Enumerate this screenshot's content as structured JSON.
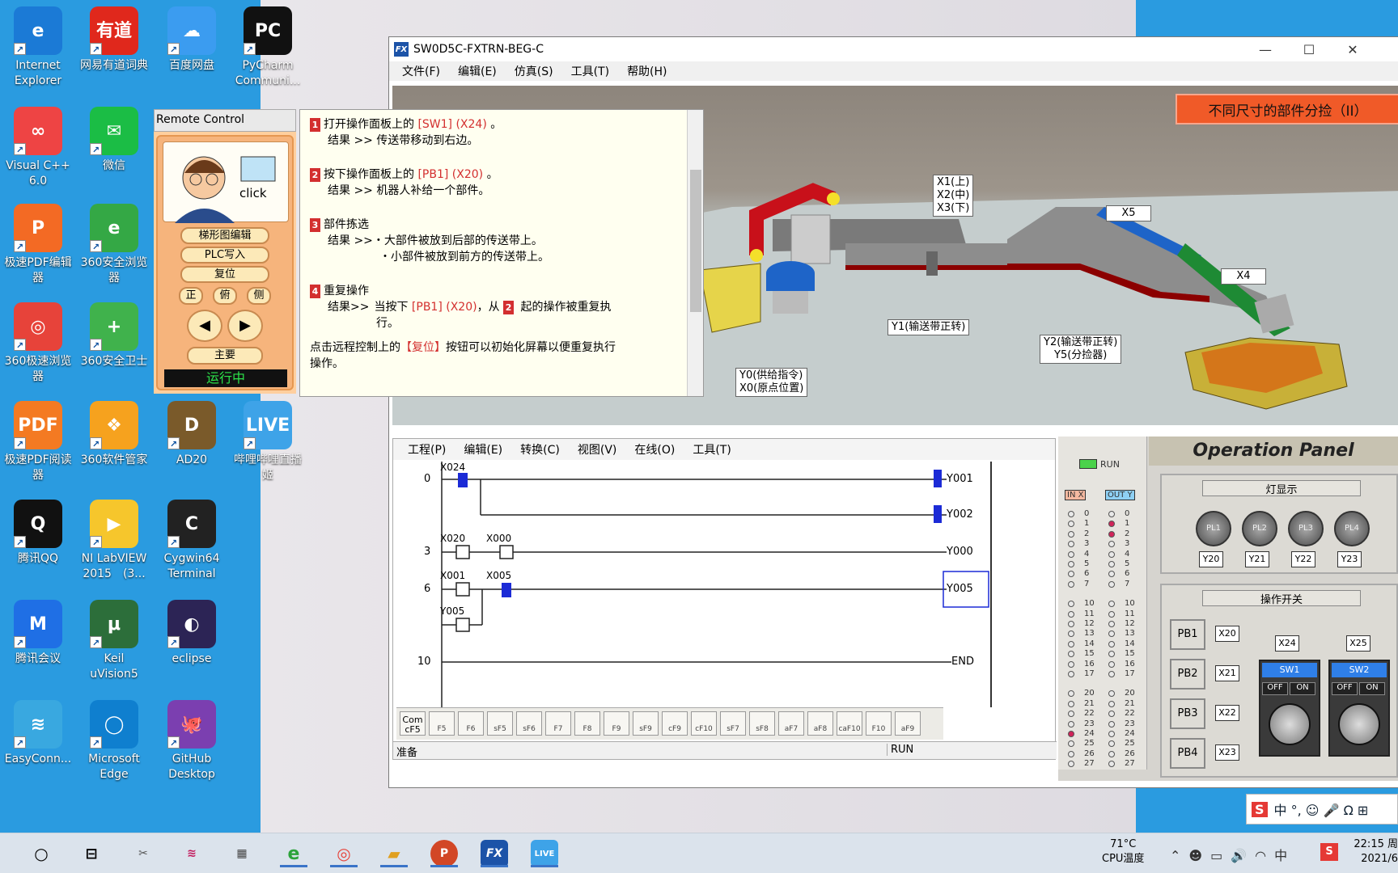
{
  "desktop": {
    "icons": [
      {
        "label": "Internet\nExplorer",
        "color": "#1b7ad6",
        "g": "e"
      },
      {
        "label": "网易有道词典",
        "color": "#e0281c",
        "g": "有道"
      },
      {
        "label": "百度网盘",
        "color": "#3b9cf0",
        "g": "☁"
      },
      {
        "label": "PyCharm\nCommuni...",
        "color": "#111",
        "g": "PC"
      },
      {
        "label": "Visual C++\n6.0",
        "color": "#e44",
        "g": "∞"
      },
      {
        "label": "微信",
        "color": "#1bbd45",
        "g": "✉"
      },
      {
        "label": "极速PDF编辑\n器",
        "color": "#f36a24",
        "g": "P"
      },
      {
        "label": "360安全浏览\n器",
        "color": "#34a845",
        "g": "e"
      },
      {
        "label": "360极速浏览\n器",
        "color": "#e7433a",
        "g": "◎"
      },
      {
        "label": "360安全卫士",
        "color": "#40b24c",
        "g": "+"
      },
      {
        "label": "极速PDF阅读\n器",
        "color": "#f47a22",
        "g": "PDF"
      },
      {
        "label": "360软件管家",
        "color": "#f6a21e",
        "g": "❖"
      },
      {
        "label": "AD20",
        "color": "#7a5a2a",
        "g": "D"
      },
      {
        "label": "哔哩哔哩直播\n姬",
        "color": "#3ea3e8",
        "g": "LIVE"
      },
      {
        "label": "腾讯QQ",
        "color": "#111",
        "g": "Q"
      },
      {
        "label": "NI LabVIEW\n2015　(3...",
        "color": "#f6c62c",
        "g": "▶"
      },
      {
        "label": "Cygwin64\nTerminal",
        "color": "#222",
        "g": "C"
      },
      {
        "label": "腾讯会议",
        "color": "#1f6fe5",
        "g": "M"
      },
      {
        "label": "Keil\nuVision5",
        "color": "#2c6e3a",
        "g": "μ"
      },
      {
        "label": "eclipse",
        "color": "#2c2455",
        "g": "◐"
      },
      {
        "label": "EasyConn...",
        "color": "#39a8e0",
        "g": "≋"
      },
      {
        "label": "Microsoft\nEdge",
        "color": "#0f7fcf",
        "g": "◯"
      },
      {
        "label": "GitHub\nDesktop",
        "color": "#7b3fb0",
        "g": "🐙"
      }
    ]
  },
  "window": {
    "title": "SW0D5C-FXTRN-BEG-C",
    "logo": "FX",
    "minimize": "—",
    "maximize": "☐",
    "close": "✕",
    "menu": [
      "文件(F)",
      "编辑(E)",
      "仿真(S)",
      "工具(T)",
      "帮助(H)"
    ]
  },
  "scene": {
    "title": "不同尺寸的部件分捡（II）",
    "labels": {
      "x123": "X1(上)\nX2(中)\nX3(下)",
      "x5": "X5",
      "x4": "X4",
      "y1": "Y1(输送带正转)",
      "y25": "Y2(输送带正转)\nY5(分捡器)",
      "y0x0": "Y0(供给指令)\nX0(原点位置)"
    }
  },
  "remote": {
    "header": "Remote Control",
    "click": "click",
    "b1": "梯形图编辑",
    "b2": "PLC写入",
    "b3": "复位",
    "v1": "正",
    "v2": "俯",
    "v3": "侧",
    "prev": "◀",
    "next": "▶",
    "main": "主要",
    "status": "运行中"
  },
  "help": {
    "s1n": "1",
    "s1a": "打开操作面板上的 ",
    "s1r": "[SW1] (X24)",
    "s1b": " 。",
    "s1res": "结果 >> 传送带移动到右边。",
    "s2n": "2",
    "s2a": "按下操作面板上的 ",
    "s2r": "[PB1] (X20)",
    "s2b": " 。",
    "s2res": "结果 >> 机器人补给一个部件。",
    "s3n": "3",
    "s3a": "部件拣选",
    "s3res1": "结果 >>・大部件被放到后部的传送带上。",
    "s3res2": "・小部件被放到前方的传送带上。",
    "s4n": "4",
    "s4a": "重复操作",
    "s4res": "结果>>",
    "s4t1": "当按下 ",
    "s4r": "[PB1] (X20)",
    "s4t2": "，从 ",
    "s4n2": "2",
    "s4t3": " 起的操作被重复执",
    "s4t4": "行。",
    "foot1": "点击远程控制上的",
    "foot2": "【复位】",
    "foot3": "按钮可以初始化屏幕以便重复执行",
    "foot4": "操作。"
  },
  "ladder": {
    "menu": [
      "工程(P)",
      "编辑(E)",
      "转换(C)",
      "视图(V)",
      "在线(O)",
      "工具(T)"
    ],
    "steps": [
      "0",
      "3",
      "6",
      "10"
    ],
    "c": {
      "x024": "X024",
      "x020": "X020",
      "x000": "X000",
      "x001": "X001",
      "x005": "X005",
      "y005c": "Y005"
    },
    "coils": {
      "y001": "Y001",
      "y002": "Y002",
      "y000": "Y000",
      "y005": "Y005",
      "end": "END"
    },
    "toolbar": [
      "Com\ncF5",
      "F5",
      "F6",
      "sF5",
      "sF6",
      "F7",
      "F8",
      "F9",
      "sF9",
      "cF9",
      "cF10",
      "sF7",
      "sF8",
      "aF7",
      "aF8",
      "caF10",
      "F10",
      "aF9"
    ],
    "status_left": "准备",
    "status_run": "RUN"
  },
  "io": {
    "run": "RUN",
    "in": "IN X",
    "out": "OUT Y",
    "rows": [
      "0",
      "1",
      "2",
      "3",
      "4",
      "5",
      "6",
      "7",
      "10",
      "11",
      "12",
      "13",
      "14",
      "15",
      "16",
      "17",
      "20",
      "21",
      "22",
      "23",
      "24",
      "25",
      "26",
      "27"
    ]
  },
  "panel": {
    "title": "Operation Panel",
    "lamps_title": "灯显示",
    "lamps": [
      "PL1",
      "PL2",
      "PL3",
      "PL4"
    ],
    "lamp_y": [
      "Y20",
      "Y21",
      "Y22",
      "Y23"
    ],
    "sw_title": "操作开关",
    "pbs": [
      "PB1",
      "PB2",
      "PB3",
      "PB4"
    ],
    "pbx": [
      "X20",
      "X21",
      "X22",
      "X23"
    ],
    "x24": "X24",
    "x25": "X25",
    "sw1": "SW1",
    "sw2": "SW2",
    "off": "OFF",
    "on": "ON"
  },
  "ime": {
    "text": "中 °, ☺ 🎤 Ω ⊞"
  },
  "taskbar": {
    "temp": "71°C",
    "cpu": "CPU温度",
    "time": "22:15 周",
    "date": "2021/6"
  }
}
